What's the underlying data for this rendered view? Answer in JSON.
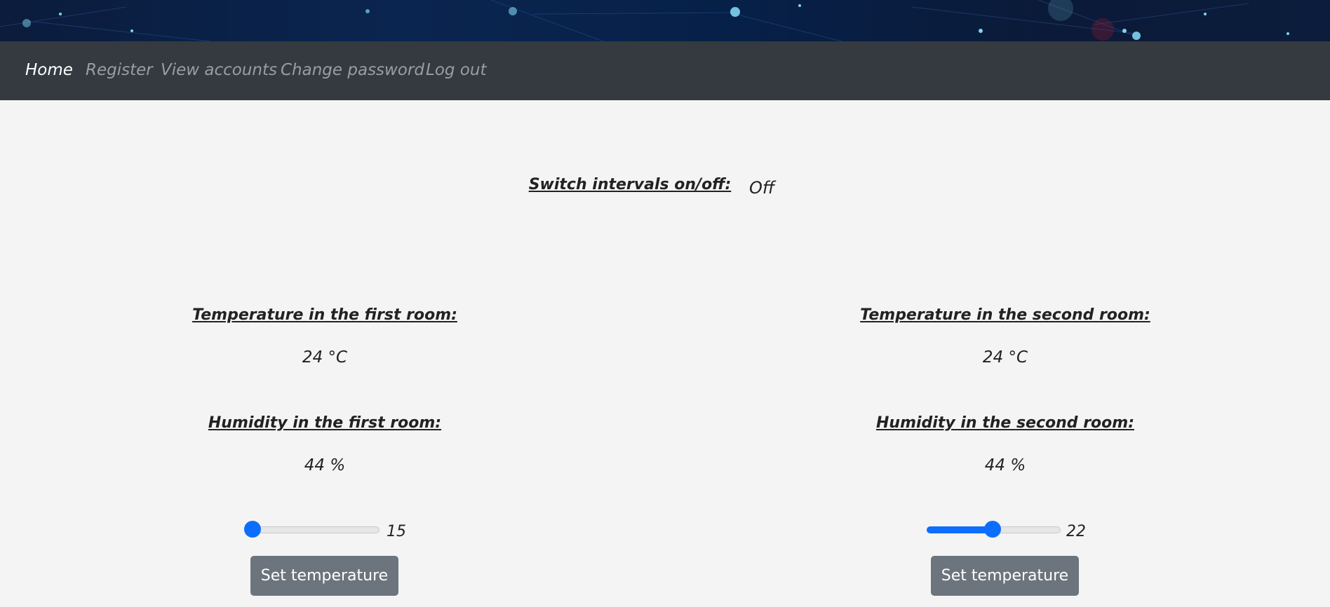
{
  "nav": {
    "items": [
      {
        "label": "Home",
        "active": true
      },
      {
        "label": "Register",
        "active": false
      },
      {
        "label": "View accounts",
        "active": false
      },
      {
        "label": "Change password",
        "active": false
      },
      {
        "label": "Log out",
        "active": false
      }
    ]
  },
  "switch": {
    "label": "Switch intervals on/off:",
    "state": "Off"
  },
  "rooms": [
    {
      "temperature_label": "Temperature in the first room:",
      "temperature_value": "24 °C",
      "humidity_label": "Humidity in the first room:",
      "humidity_value": "44 %",
      "slider_value": "15",
      "slider_min": 15,
      "slider_max": 30,
      "button_label": "Set temperature"
    },
    {
      "temperature_label": "Temperature in the second room:",
      "temperature_value": "24 °C",
      "humidity_label": "Humidity in the second room:",
      "humidity_value": "44 %",
      "slider_value": "22",
      "slider_min": 15,
      "slider_max": 30,
      "button_label": "Set temperature"
    }
  ],
  "colors": {
    "accent": "#0d6efd",
    "navbar": "#343a40",
    "button": "#6c757d",
    "background": "#f4f4f4"
  }
}
